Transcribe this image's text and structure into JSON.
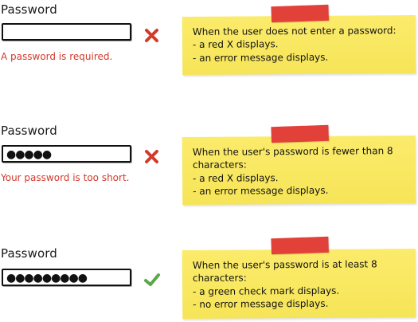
{
  "examples": [
    {
      "label": "Password",
      "input_value": "",
      "status_icon": "red-x-icon",
      "error_message": "A password is required.",
      "note": {
        "heading": "When the user does not enter a password:",
        "bullets": [
          "- a red X displays.",
          "- an error message displays."
        ]
      }
    },
    {
      "label": "Password",
      "input_value": "●●●●●",
      "status_icon": "red-x-icon",
      "error_message": "Your password is too short.",
      "note": {
        "heading": "When the user's password is fewer than 8\ncharacters:",
        "bullets": [
          "- a red X displays.",
          "- an error message displays."
        ]
      }
    },
    {
      "label": "Password",
      "input_value": "●●●●●●●●●",
      "status_icon": "green-check-icon",
      "error_message": "",
      "note": {
        "heading": "When the user's password is at least 8\ncharacters:",
        "bullets": [
          "- a green check mark displays.",
          "- no error message displays."
        ]
      }
    }
  ],
  "colors": {
    "error_red": "#d23a2a",
    "success_green": "#5aa84a",
    "note_yellow": "#fbe95a",
    "tape_red": "#e2413a"
  }
}
